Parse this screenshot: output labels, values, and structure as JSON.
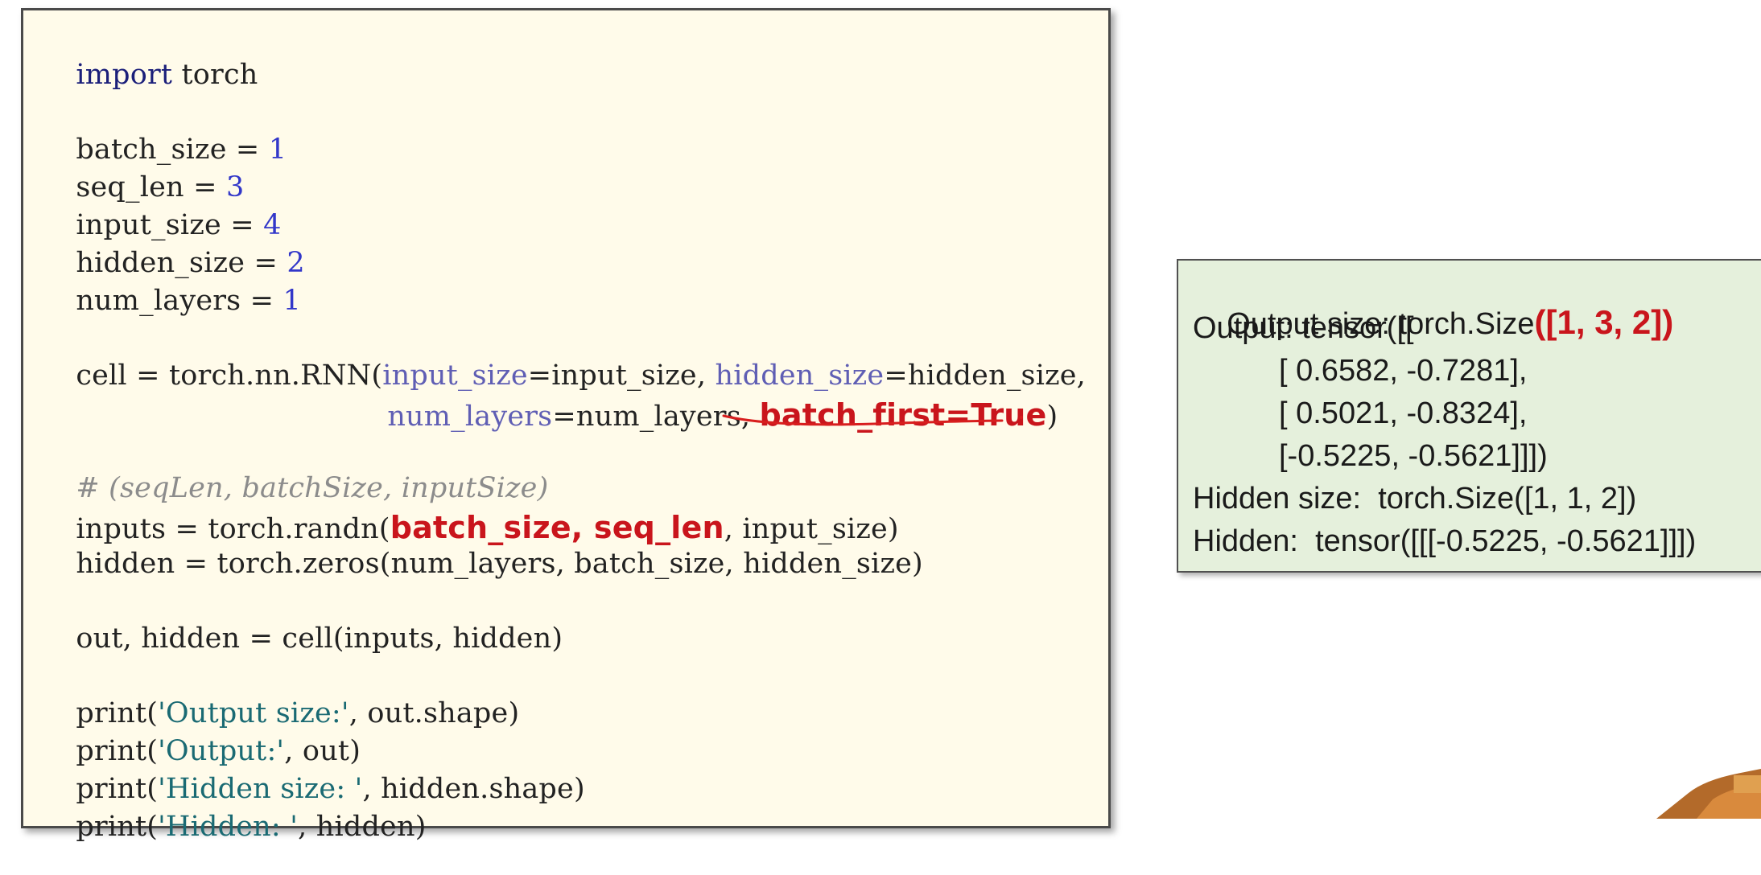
{
  "code": {
    "l1": {
      "kw": "import",
      "rest": " torch"
    },
    "l2": {
      "name": "batch_size",
      "op": " = ",
      "val": "1"
    },
    "l3": {
      "name": "seq_len",
      "op": " = ",
      "val": "3"
    },
    "l4": {
      "name": "input_size",
      "op": " = ",
      "val": "4"
    },
    "l5": {
      "name": "hidden_size",
      "op": " = ",
      "val": "2"
    },
    "l6": {
      "name": "num_layers",
      "op": " = ",
      "val": "1"
    },
    "l7": {
      "a": "cell = torch.nn.RNN(",
      "p1": "input_size",
      "b": "=input_size, ",
      "p2": "hidden_size",
      "c": "=hidden_size,"
    },
    "l8": {
      "p3": "num_layers",
      "a": "=num_layers, ",
      "hl": "batch_first=True",
      "b": ")"
    },
    "l9": {
      "comment": "# (seqLen, batchSize, inputSize)"
    },
    "l10": {
      "a": "inputs = torch.randn(",
      "hl": "batch_size, seq_len",
      "b": ", input_size)"
    },
    "l11": {
      "text": "hidden = torch.zeros(num_layers, batch_size, hidden_size)"
    },
    "l12": {
      "text": "out, hidden = cell(inputs, hidden)"
    },
    "l13": {
      "fn": "print(",
      "str": "'Output size:'",
      "rest": ", out.shape)"
    },
    "l14": {
      "fn": "print(",
      "str": "'Output:'",
      "rest": ", out)"
    },
    "l15": {
      "fn": "print(",
      "str": "'Hidden size: '",
      "rest": ", hidden.shape)"
    },
    "l16": {
      "fn": "print(",
      "str": "'Hidden: '",
      "rest": ", hidden)"
    }
  },
  "output": {
    "o1": {
      "a": "Output size: torch.Size",
      "hl": "([1, 3, 2])"
    },
    "o2": "Output: tensor([[",
    "o3": "[ 0.6582, -0.7281],",
    "o4": "[ 0.5021, -0.8324],",
    "o5": "[-0.5225, -0.5621]]])",
    "o6": "Hidden size:  torch.Size([1, 1, 2])",
    "o7": "Hidden:  tensor([[[-0.5225, -0.5621]]])"
  },
  "colors": {
    "code_bg": "#fffbea",
    "output_bg": "#e5f0dc",
    "highlight": "#c9151c",
    "keyword": "#1b1f7a",
    "number": "#3237c9",
    "string": "#1a6a73"
  }
}
